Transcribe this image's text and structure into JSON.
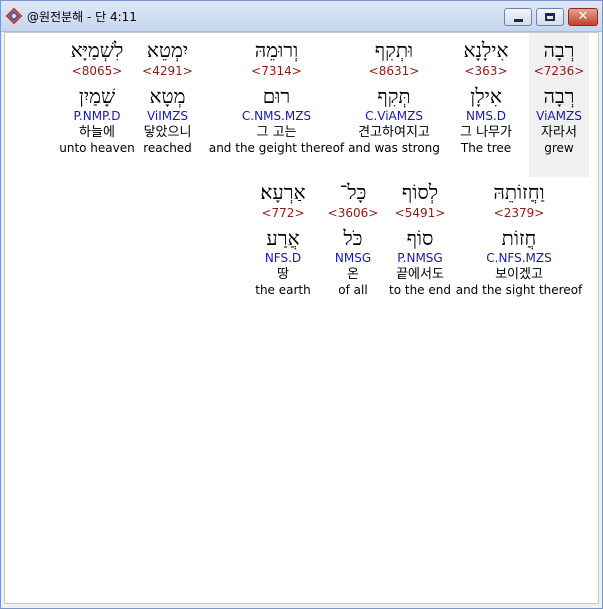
{
  "window": {
    "title": "@원전분해 - 단 4:11",
    "close_glyph": "✕"
  },
  "words": [
    {
      "hebrew": "רְבָה",
      "strong": "<7236>",
      "lemma": "רְבָה",
      "morph": "ViAMZS",
      "korean": "자라서",
      "english": "grew",
      "highlight": true
    },
    {
      "hebrew": "אִילָנָא",
      "strong": "<363>",
      "lemma": "אִילָן",
      "morph": "NMS.D",
      "korean": "그 나무가",
      "english": "The tree",
      "highlight": false
    },
    {
      "hebrew": "וּתְקִף",
      "strong": "<8631>",
      "lemma": "תְּקִף",
      "morph": "C.ViAMZS",
      "korean": "견고하여지고",
      "english": "and was strong",
      "highlight": false
    },
    {
      "hebrew": "וְרוּמֵהּ",
      "strong": "<7314>",
      "lemma": "רוּם",
      "morph": "C.NMS.MZS",
      "korean": "그 고는",
      "english": "and the geight thereof",
      "highlight": false
    },
    {
      "hebrew": "יִמְטֵא",
      "strong": "<4291>",
      "lemma": "מְטָא",
      "morph": "ViIMZS",
      "korean": "닿았으니",
      "english": "reached",
      "highlight": false
    },
    {
      "hebrew": "לִשְׁמַיָּא",
      "strong": "<8065>",
      "lemma": "שָׁמַיִן",
      "morph": "P.NMP.D",
      "korean": "하늘에",
      "english": "unto heaven",
      "highlight": false
    },
    {
      "hebrew": "וַחֲזוֹתֵהּ",
      "strong": "<2379>",
      "lemma": "חֲזוֹת",
      "morph": "C.NFS.MZS",
      "korean": "보이겠고",
      "english": "and the sight thereof",
      "highlight": false
    },
    {
      "hebrew": "לְסוֹף",
      "strong": "<5491>",
      "lemma": "סוֹף",
      "morph": "P.NMSG",
      "korean": "끝에서도",
      "english": "to the end",
      "highlight": false
    },
    {
      "hebrew": "כָּל־",
      "strong": "<3606>",
      "lemma": "כֹּל",
      "morph": "NMSG",
      "korean": "온",
      "english": "of all",
      "highlight": false
    },
    {
      "hebrew": "אַרְעָא׃",
      "strong": "<772>",
      "lemma": "אֲרַע",
      "morph": "NFS.D",
      "korean": "땅",
      "english": "the earth",
      "highlight": false
    }
  ]
}
